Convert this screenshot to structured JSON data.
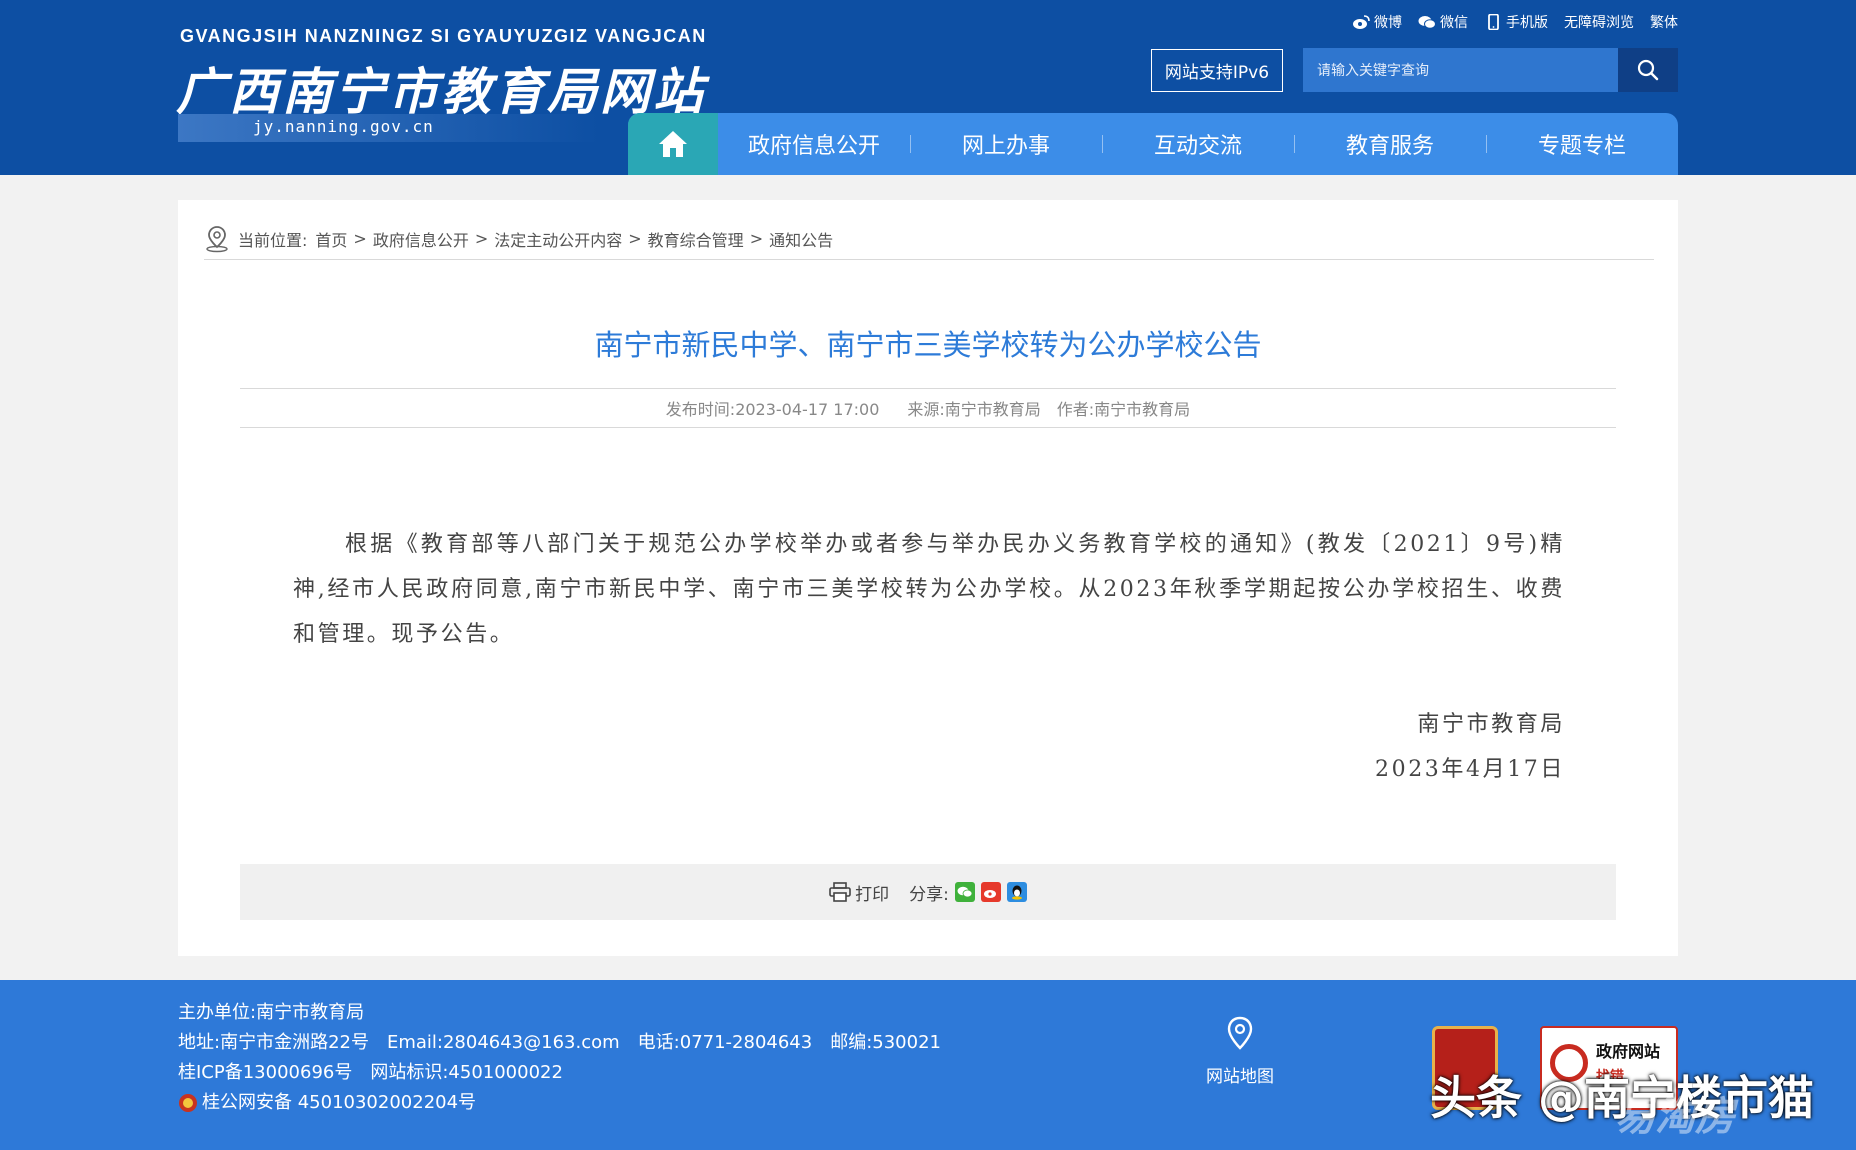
{
  "header": {
    "pinyin": "GVANGJSIH NANZNINGZ SI GYAUYUZGIZ VANGJCAN",
    "site_title": "广西南宁市教育局网站",
    "domain": "jy.nanning.gov.cn",
    "top_links": [
      "微博",
      "微信",
      "手机版",
      "无障碍浏览",
      "繁体"
    ],
    "ipv6_label": "网站支持IPv6",
    "search_placeholder": "请输入关键字查询"
  },
  "nav": {
    "items": [
      "政府信息公开",
      "网上办事",
      "互动交流",
      "教育服务",
      "专题专栏"
    ]
  },
  "breadcrumb": {
    "label": "当前位置:",
    "items": [
      "首页",
      "政府信息公开",
      "法定主动公开内容",
      "教育综合管理",
      "通知公告"
    ],
    "separator": ">"
  },
  "article": {
    "title": "南宁市新民中学、南宁市三美学校转为公办学校公告",
    "publish_time": "发布时间:2023-04-17 17:00",
    "source": "来源:南宁市教育局",
    "author": "作者:南宁市教育局",
    "body": "根据《教育部等八部门关于规范公办学校举办或者参与举办民办义务教育学校的通知》(教发〔2021〕9号)精神,经市人民政府同意,南宁市新民中学、南宁市三美学校转为公办学校。从2023年秋季学期起按公办学校招生、收费和管理。现予公告。",
    "sign_org": "南宁市教育局",
    "sign_date": "2023年4月17日"
  },
  "toolbar": {
    "print": "打印",
    "share": "分享:"
  },
  "footer": {
    "sponsor": "主办单位:南宁市教育局",
    "address": "地址:南宁市金洲路22号",
    "email": "Email:2804643@163.com",
    "phone": "电话:0771-2804643",
    "postcode": "邮编:530021",
    "icp": "桂ICP备13000696号",
    "site_id": "网站标识:4501000022",
    "police": "桂公网安备 45010302002204号",
    "sitemap": "网站地图",
    "badge_text": "政府网站",
    "badge_sub": "找错",
    "watermark": "头条 @南宁楼市猫",
    "watermark2": "易淘房"
  },
  "colors": {
    "header_bg": "#0d4fa3",
    "nav_bg": "#3c8de8",
    "home_bg": "#2aa7b5",
    "title_blue": "#2d7bd8",
    "footer_bg": "#2e79d8"
  }
}
